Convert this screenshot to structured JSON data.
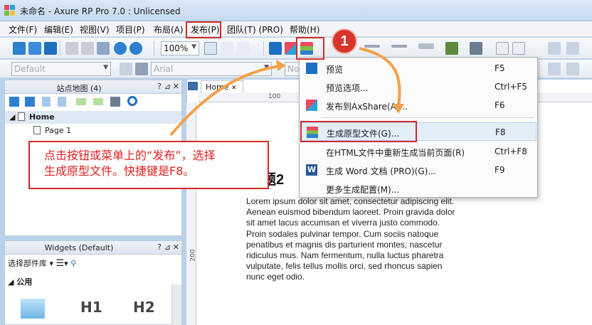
{
  "window": {
    "title": "未命名 - Axure RP Pro 7.0 : Unlicensed"
  },
  "menubar": {
    "items": [
      {
        "label": "文件(F)"
      },
      {
        "label": "编辑(E)"
      },
      {
        "label": "视图(V)"
      },
      {
        "label": "项目(P)"
      },
      {
        "label": "布局(A)"
      },
      {
        "label": "发布(P)"
      },
      {
        "label": "团队(T) (PRO)"
      },
      {
        "label": "帮助(H)"
      }
    ]
  },
  "toolbar": {
    "zoom": "100%",
    "font_style": "Default",
    "font_family": "Arial",
    "text_style": "Norma"
  },
  "sitemap": {
    "title": "站点地图 (4)",
    "help": "?",
    "pages": [
      {
        "label": "Home"
      },
      {
        "label": "Page 1"
      }
    ]
  },
  "widgets": {
    "title": "Widgets (Default)",
    "help": "?",
    "library_label": "选择部件库",
    "section": "公用",
    "items": [
      {
        "label": "H1"
      },
      {
        "label": "H2"
      }
    ]
  },
  "canvas": {
    "tab": "Home",
    "ruler_top": [
      "100"
    ],
    "ruler_left": [
      "200"
    ],
    "heading": "题2",
    "paragraph": "Lorem ipsum dolor sit amet, consectetur adipiscing elit. Aenean euismod bibendum laoreet. Proin gravida dolor sit amet lacus accumsan et viverra justo commodo. Proin sodales pulvinar tempor. Cum sociis natoque penatibus et magnis dis parturient montes, nascetur ridiculus mus. Nam fermentum, nulla luctus pharetra vulputate, felis tellus mollis orci, sed rhoncus sapien nunc eget odio."
  },
  "publish_menu": {
    "items": [
      {
        "label": "预览",
        "shortcut": "F5",
        "icon": "play-icon"
      },
      {
        "label": "预览选项...",
        "shortcut": "Ctrl+F5",
        "icon": ""
      },
      {
        "label": "发布到AxShare(A)...",
        "shortcut": "F6",
        "icon": "axshare-icon"
      },
      {
        "label": "生成原型文件(G)...",
        "shortcut": "F8",
        "icon": "prototype-icon"
      },
      {
        "label": "在HTML文件中重新生成当前页面(R)",
        "shortcut": "Ctrl+F8",
        "icon": ""
      },
      {
        "label": "生成 Word 文档 (PRO)(G)...",
        "shortcut": "F9",
        "icon": "word-icon"
      },
      {
        "label": "更多生成配置(M)...",
        "shortcut": "",
        "icon": ""
      }
    ]
  },
  "annotation": {
    "badge": "1",
    "line1": "点击按钮或菜单上的“发布”，选择",
    "line2": "生成原型文件。快捷键是F8。"
  },
  "colors": {
    "highlight": "#d22b2b",
    "arrow": "#f2a24a",
    "menu_highlight": "#e3eef9"
  }
}
